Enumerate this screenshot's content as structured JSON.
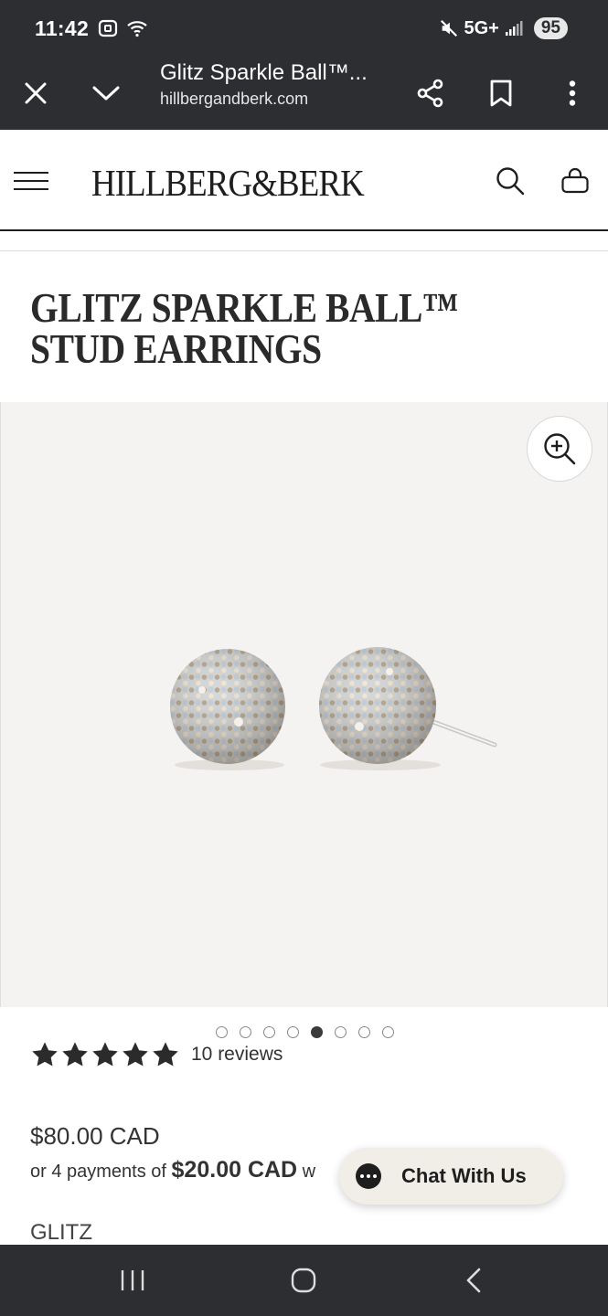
{
  "status_bar": {
    "time": "11:42",
    "network": "5G+",
    "battery": "95"
  },
  "browser": {
    "page_title": "Glitz Sparkle Ball™...",
    "host": "hillbergandberk.com"
  },
  "site": {
    "brand": "HILLBERG&BERK"
  },
  "product": {
    "title": "GLITZ SPARKLE BALL™ STUD EARRINGS",
    "reviews_label": "10 reviews",
    "rating": 5,
    "price": "$80.00 CAD",
    "installments_prefix": "or 4 payments of ",
    "installment_amount": "$20.00 CAD",
    "installments_suffix": " w",
    "collection": "GLITZ"
  },
  "gallery": {
    "image_count": 8,
    "active_index": 4
  },
  "chat": {
    "label": "Chat With Us"
  },
  "icons": {
    "close": "close-icon",
    "dropdown": "chevron-down-icon",
    "share": "share-icon",
    "bookmark": "bookmark-icon",
    "more": "more-vertical-icon",
    "menu": "hamburger-menu-icon",
    "search": "search-icon",
    "bag": "shopping-bag-icon",
    "zoom": "zoom-in-icon"
  },
  "colors": {
    "system_bar": "#2d2e31",
    "gallery_bg": "#f4f3f2",
    "star": "#2b2b2b",
    "chat_bg": "#f1eee8"
  }
}
